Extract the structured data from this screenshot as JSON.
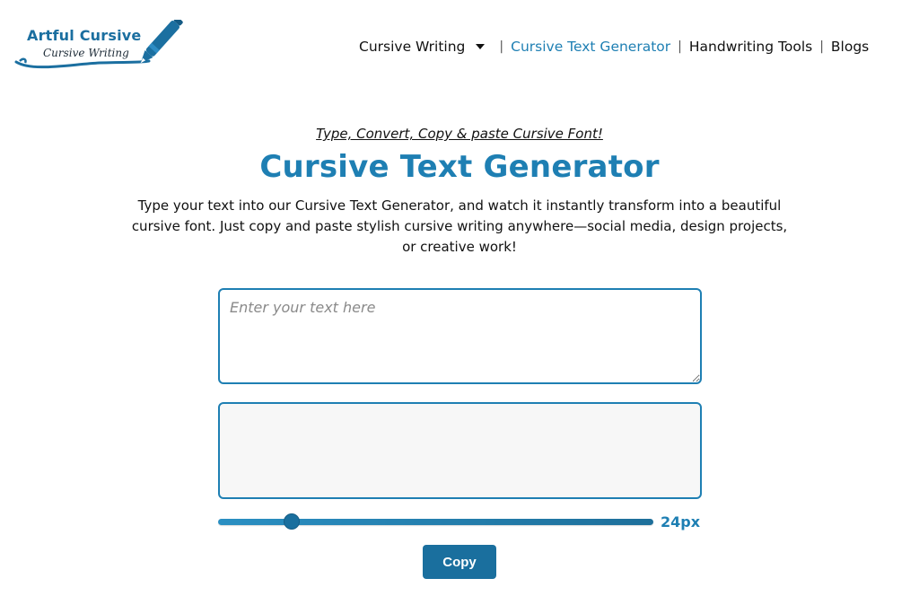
{
  "logo": {
    "title": "Artful Cursive",
    "subtitle": "Cursive Writing",
    "brand_color": "#1b6fa0"
  },
  "nav": {
    "items": [
      {
        "label": "Cursive Writing",
        "has_dropdown": true,
        "active": false
      },
      {
        "label": "Cursive Text Generator",
        "active": true
      },
      {
        "label": "Handwriting Tools",
        "active": false
      },
      {
        "label": "Blogs",
        "active": false
      }
    ],
    "separator": "|",
    "active_color": "#1e7fb3"
  },
  "hero": {
    "tagline": "Type, Convert, Copy & paste Cursive Font!",
    "title": "Cursive Text Generator",
    "description": "Type your text into our Cursive Text Generator, and watch it instantly transform into a beautiful cursive font. Just copy and paste stylish cursive writing anywhere—social media, design projects, or creative work!"
  },
  "generator": {
    "input_placeholder": "Enter your text here",
    "input_value": "",
    "output_value": "",
    "font_size": {
      "label": "24px",
      "value": 24,
      "min": 10,
      "max": 100
    },
    "copy_label": "Copy"
  },
  "colors": {
    "accent": "#1e7fb3",
    "button": "#1a6f9e"
  }
}
